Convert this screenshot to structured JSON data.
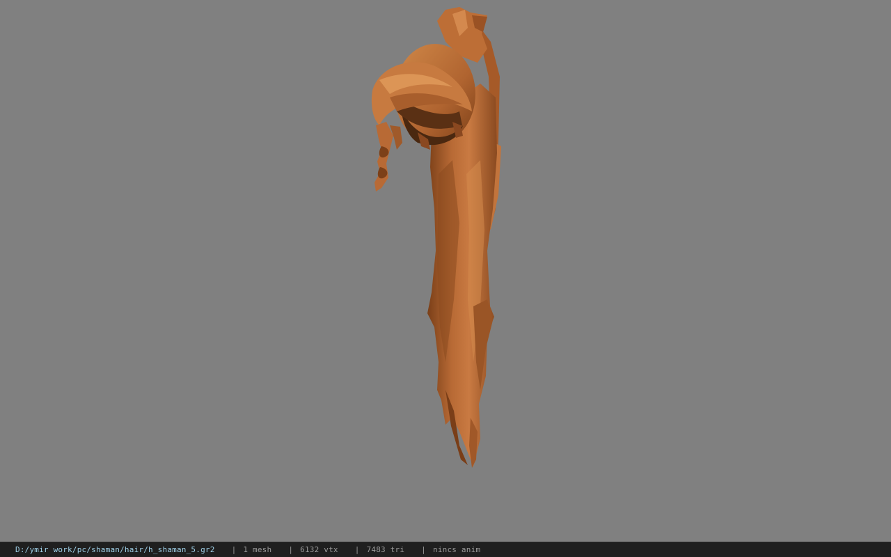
{
  "viewer": {
    "background_color": "#808080",
    "model_color": "#b86a35",
    "model": "hair-mesh"
  },
  "status": {
    "file_path": "D:/ymir work/pc/shaman/hair/h_shaman_5.gr2",
    "separator": "|",
    "mesh_count": "1 mesh",
    "vertex_count": "6132 vtx",
    "triangle_count": "7483 tri",
    "animation": "nincs anim"
  }
}
